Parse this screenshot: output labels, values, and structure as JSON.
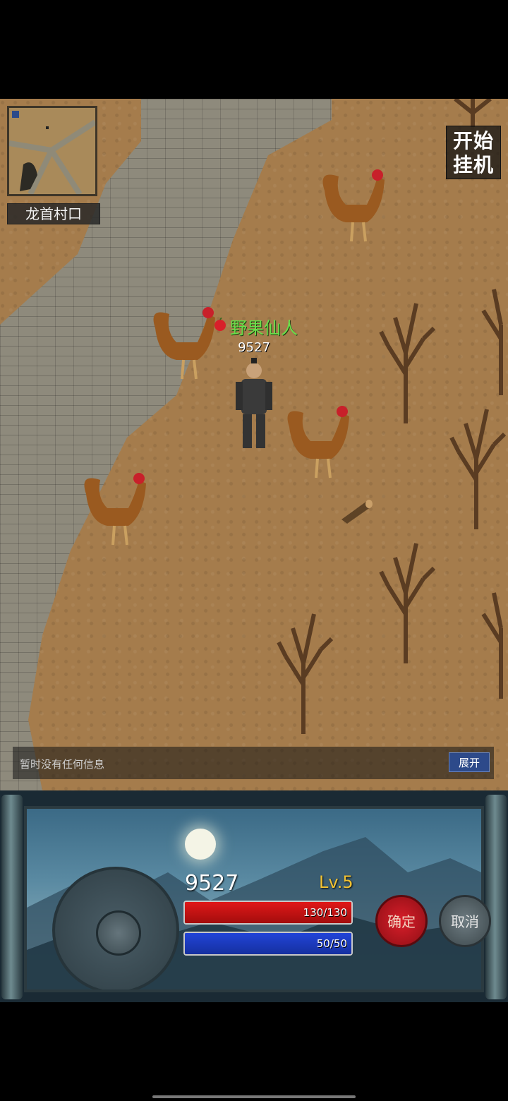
{
  "map": {
    "location_name": "龙首村口",
    "auto_battle_label": "开始挂机",
    "npc_name": "野果仙人",
    "player_name": "9527"
  },
  "message_bar": {
    "text": "暂时没有任何信息",
    "expand_label": "展开"
  },
  "panel": {
    "player_name": "9527",
    "level": "Lv.5",
    "hp_text": "130/130",
    "hp_fraction": 1.0,
    "mp_text": "50/50",
    "mp_fraction": 1.0,
    "confirm_label": "确定",
    "cancel_label": "取消"
  },
  "colors": {
    "npc_name": "#6adf4a",
    "level": "#f1c232",
    "hp": "#e01818",
    "mp": "#2244d8"
  }
}
